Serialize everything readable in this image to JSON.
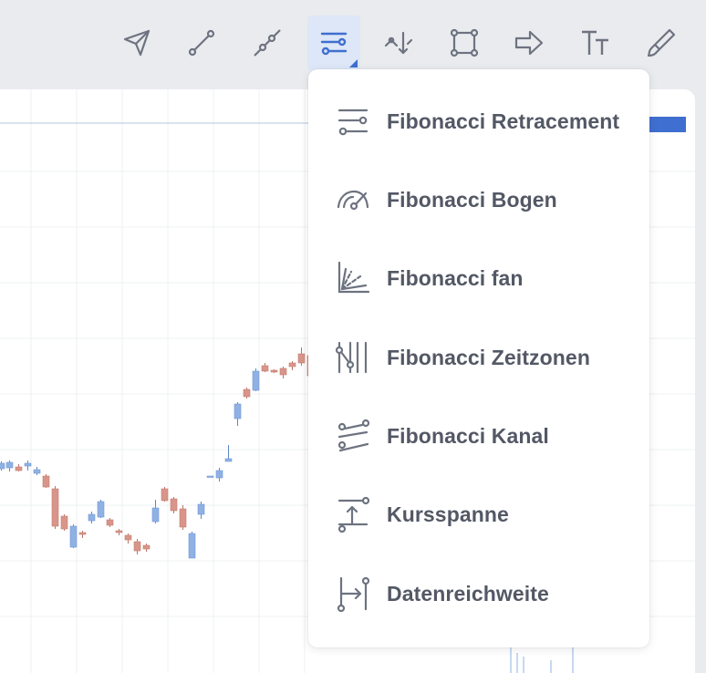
{
  "colors": {
    "icon": "#6d7380",
    "active_icon": "#3f6fd0",
    "active_bg": "#dde7f7",
    "up_candle": "#8fb1e4",
    "down_candle": "#d9958a",
    "menu_text": "#535865"
  },
  "toolbar": {
    "tools": [
      {
        "name": "arrow-cursor-icon",
        "active": false
      },
      {
        "name": "trend-line-icon",
        "active": false
      },
      {
        "name": "extended-line-icon",
        "active": false
      },
      {
        "name": "fibonacci-tools-icon",
        "active": true
      },
      {
        "name": "patterns-icon",
        "active": false
      },
      {
        "name": "rectangle-icon",
        "active": false
      },
      {
        "name": "arrow-shape-icon",
        "active": false
      },
      {
        "name": "text-icon",
        "active": false
      },
      {
        "name": "brush-icon",
        "active": false
      }
    ]
  },
  "menu": {
    "items": [
      {
        "label": "Fibonacci Retracement",
        "icon": "fib-retracement-icon"
      },
      {
        "label": "Fibonacci Bogen",
        "icon": "fib-arc-icon"
      },
      {
        "label": "Fibonacci fan",
        "icon": "fib-fan-icon"
      },
      {
        "label": "Fibonacci Zeitzonen",
        "icon": "fib-timezones-icon"
      },
      {
        "label": "Fibonacci Kanal",
        "icon": "fib-channel-icon"
      },
      {
        "label": "Kursspanne",
        "icon": "price-range-icon"
      },
      {
        "label": "Datenreichweite",
        "icon": "date-range-icon"
      }
    ]
  }
}
